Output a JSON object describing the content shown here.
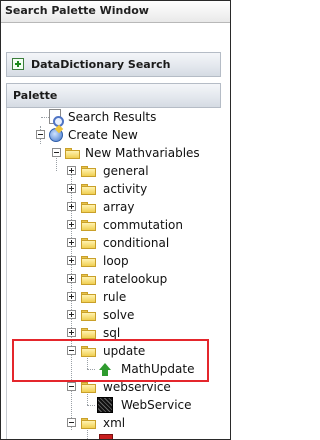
{
  "window": {
    "title": "Search Palette Window"
  },
  "panels": {
    "datadictionary": {
      "label": "DataDictionary Search",
      "icon": "plus-box-icon"
    },
    "palette": {
      "label": "Palette"
    }
  },
  "tree": {
    "search_results": "Search Results",
    "create_new": "Create New",
    "new_mathvariables": "New Mathvariables",
    "children": [
      {
        "label": "general"
      },
      {
        "label": "activity"
      },
      {
        "label": "array"
      },
      {
        "label": "commutation"
      },
      {
        "label": "conditional"
      },
      {
        "label": "loop"
      },
      {
        "label": "ratelookup"
      },
      {
        "label": "rule"
      },
      {
        "label": "solve"
      },
      {
        "label": "sql"
      },
      {
        "label": "update"
      },
      {
        "label": "MathUpdate"
      },
      {
        "label": "webservice"
      },
      {
        "label": "WebService"
      },
      {
        "label": "xml"
      }
    ]
  },
  "colors": {
    "highlight_border": "#e4262c",
    "folder": "#f0cf52"
  }
}
